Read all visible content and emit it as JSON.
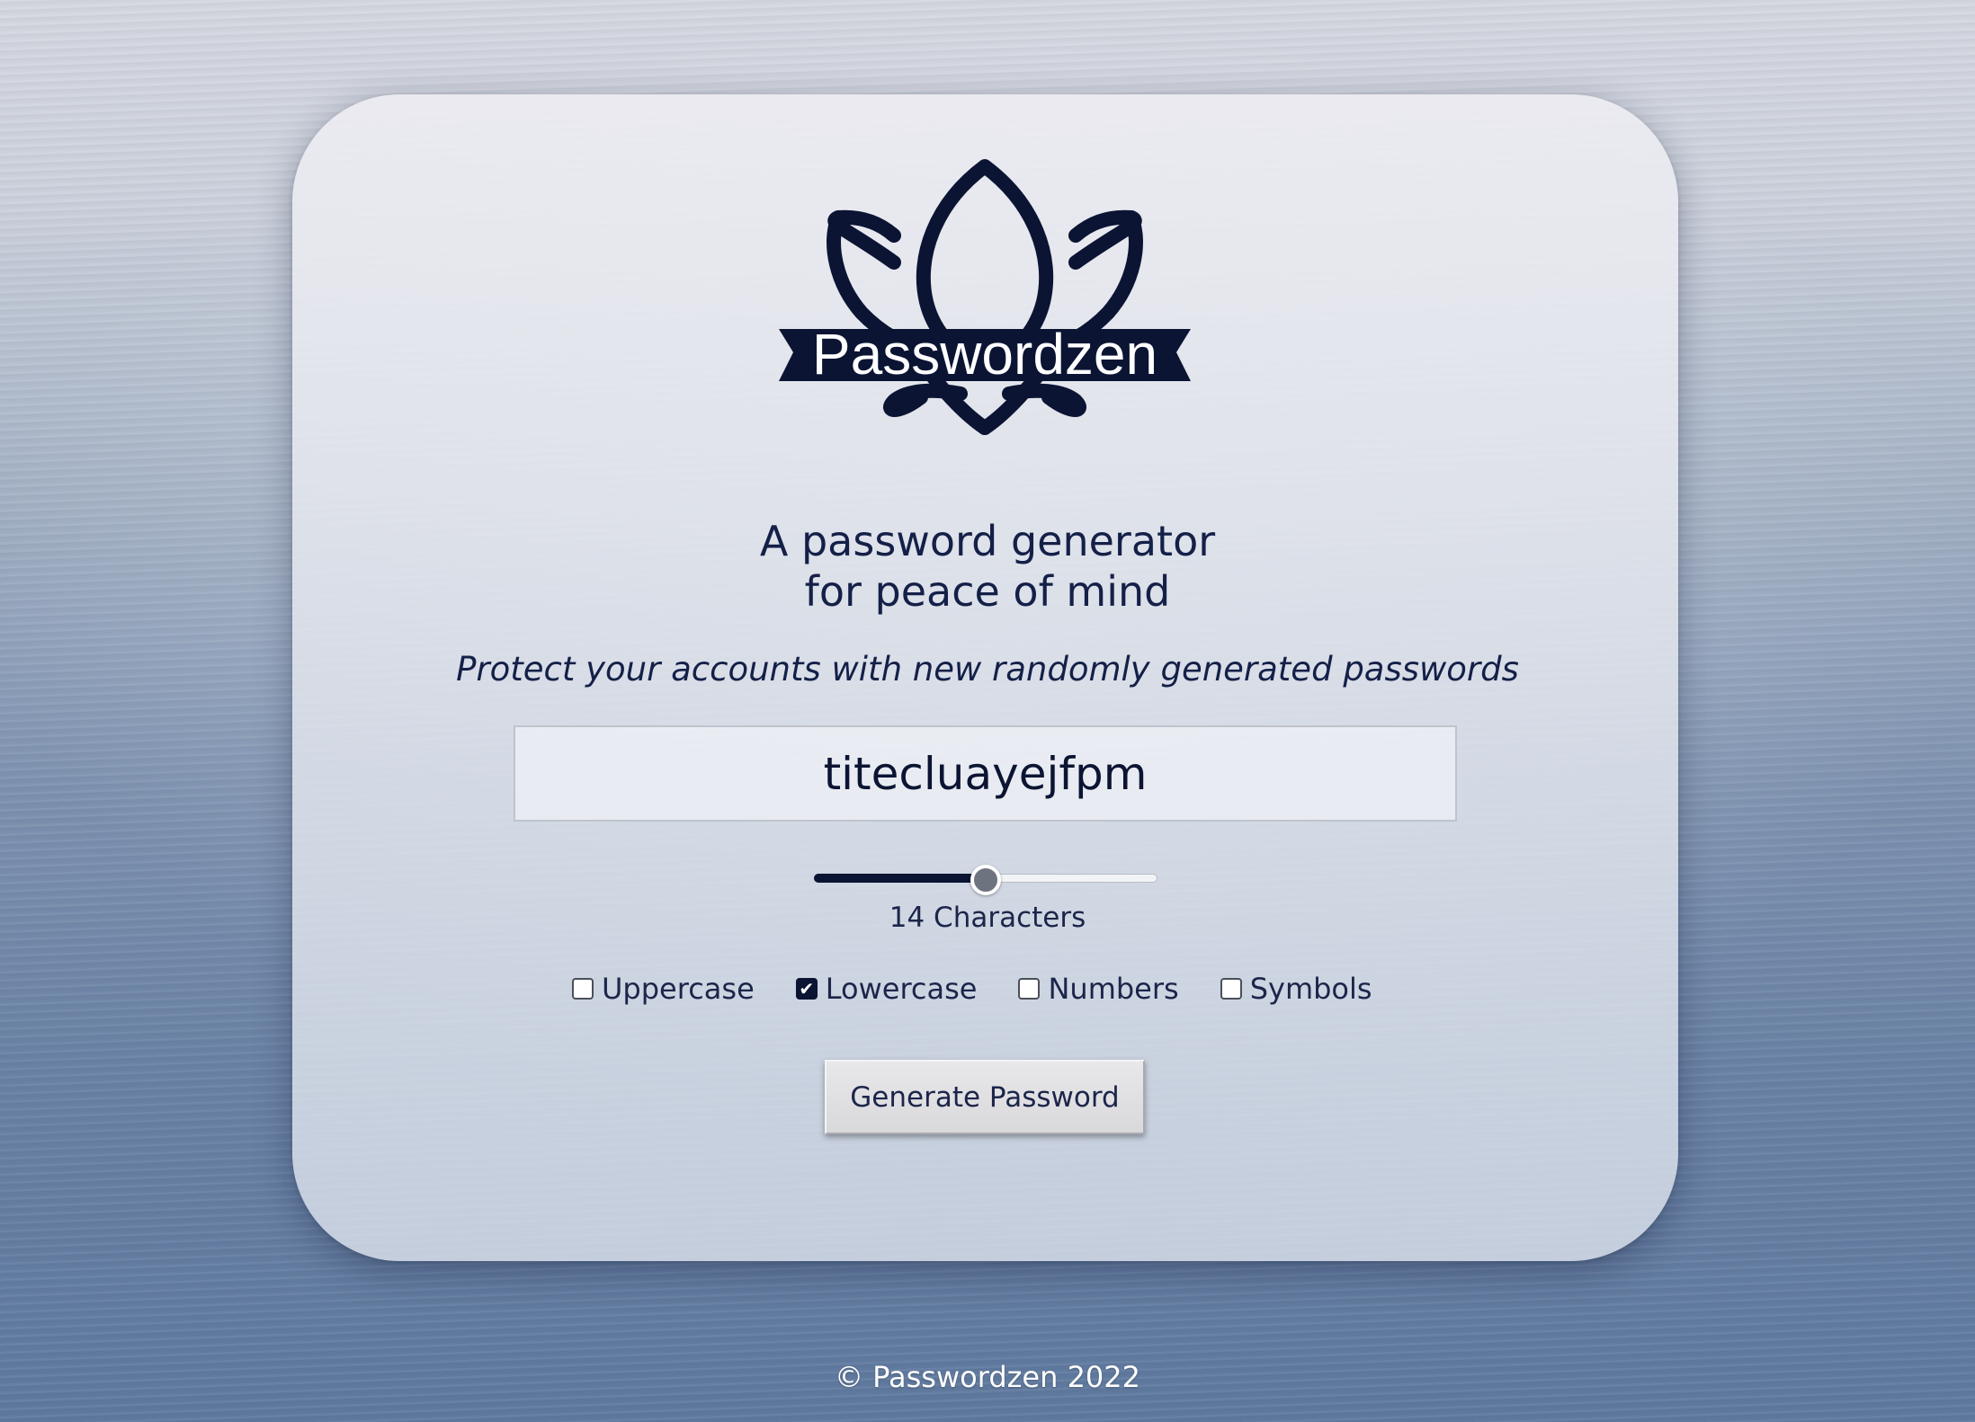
{
  "brand": {
    "logo_text": "Passwordzen",
    "logo_icon": "lotus-icon",
    "accent_color": "#0b1433"
  },
  "hero": {
    "headline_line1": "A password generator",
    "headline_line2": "for peace of mind",
    "subtitle": "Protect your accounts with new randomly generated passwords"
  },
  "generator": {
    "password": "titecluayejfpm",
    "length": 14,
    "length_min": 8,
    "length_max": 20,
    "length_label": "14 Characters",
    "options": [
      {
        "label": "Uppercase",
        "checked": false
      },
      {
        "label": "Lowercase",
        "checked": true
      },
      {
        "label": "Numbers",
        "checked": false
      },
      {
        "label": "Symbols",
        "checked": false
      }
    ],
    "generate_label": "Generate Password"
  },
  "footer": {
    "copyright": "© Passwordzen 2022"
  }
}
